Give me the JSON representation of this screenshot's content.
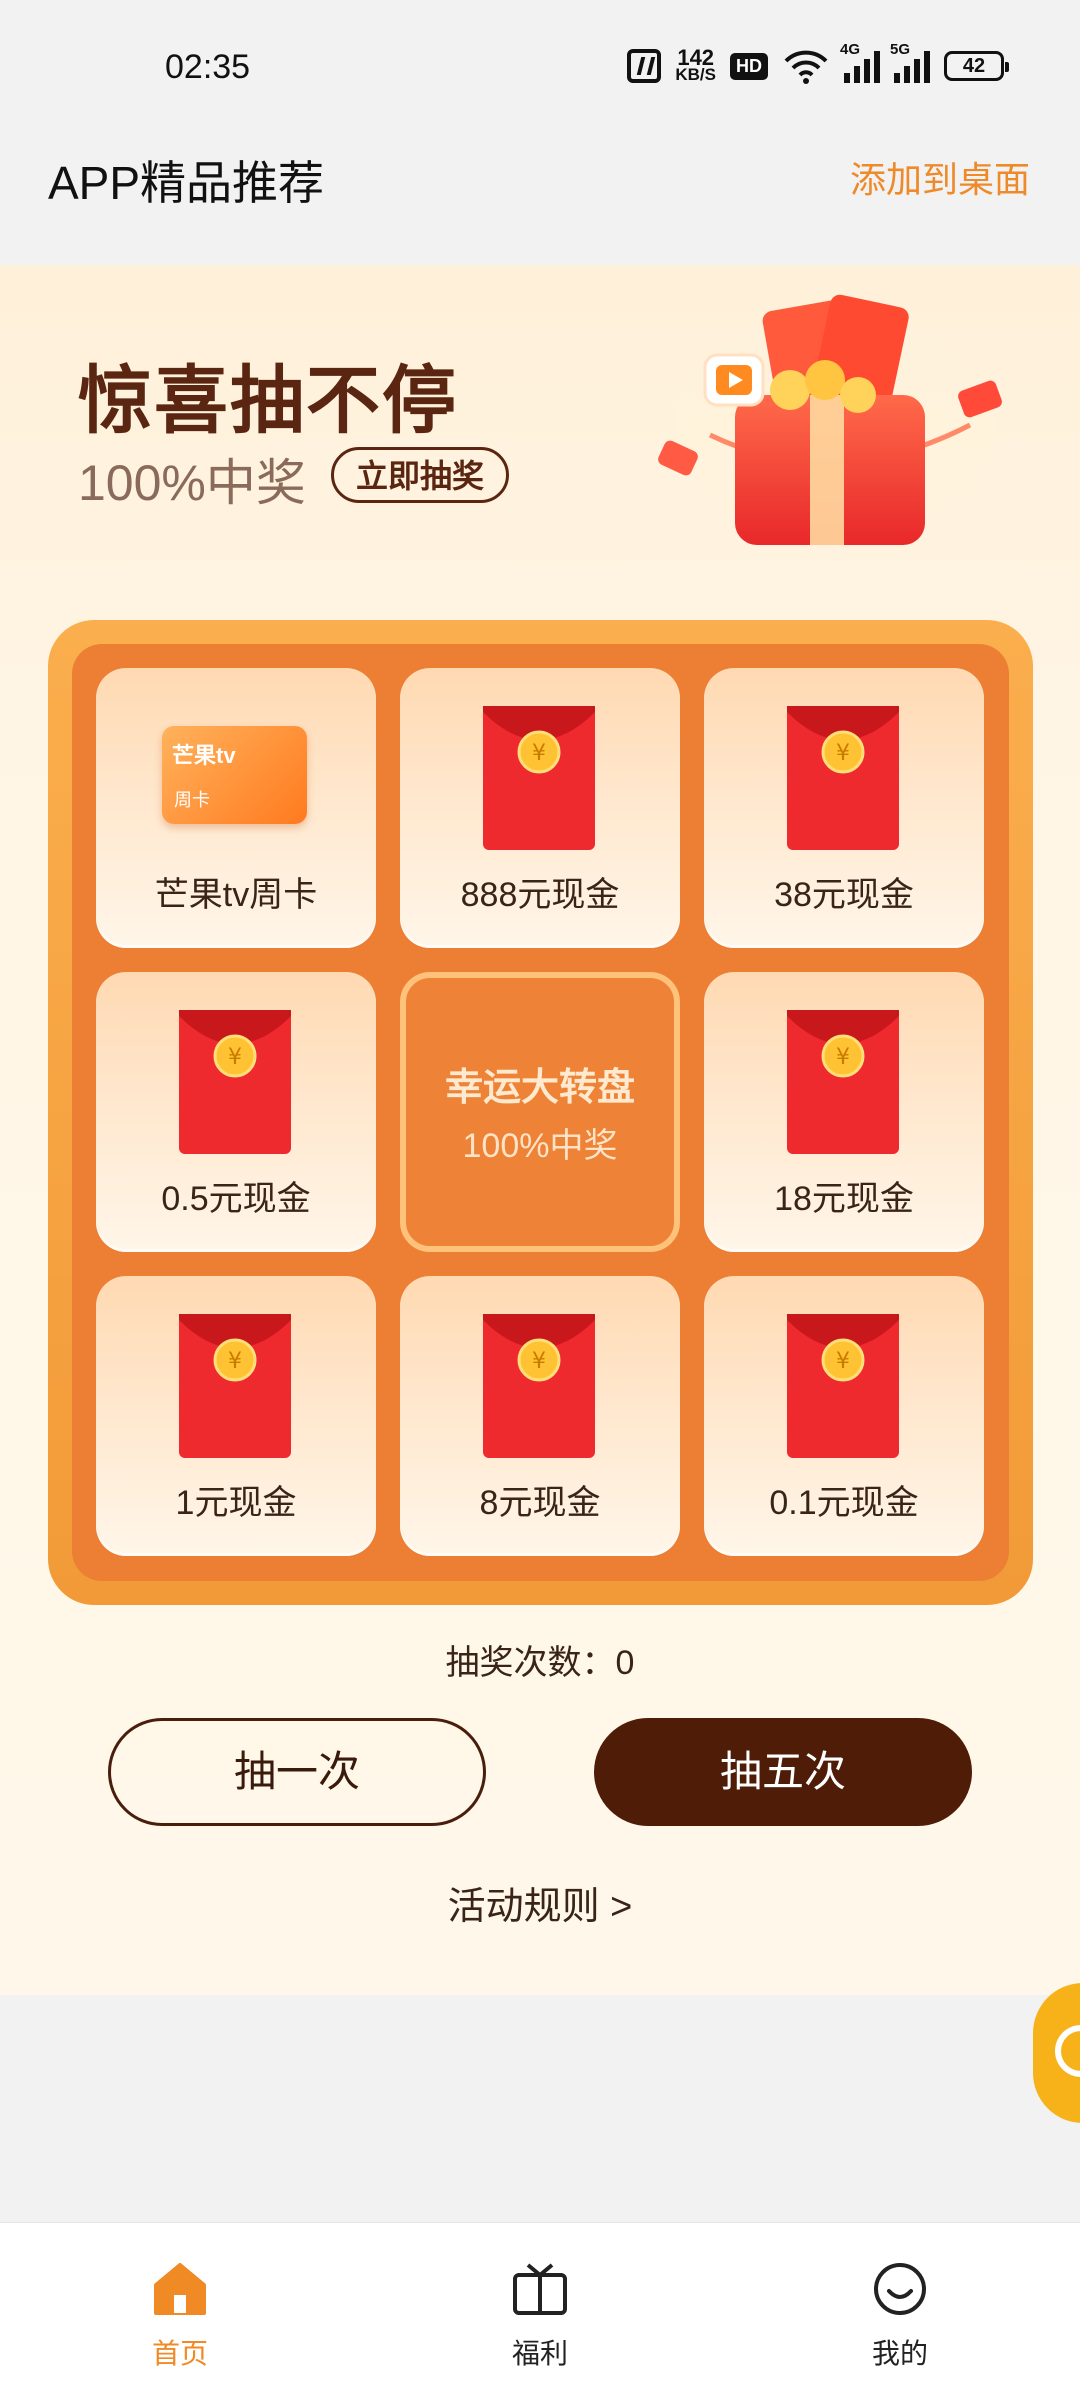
{
  "status": {
    "time": "02:35",
    "net_speed": "142",
    "net_unit": "KB/S",
    "hd": "HD",
    "sig1": "4G",
    "sig2": "5G",
    "battery": "42"
  },
  "header": {
    "title": "APP精品推荐",
    "add_to_desktop": "添加到桌面"
  },
  "banner": {
    "title": "惊喜抽不停",
    "subtitle": "100%中奖",
    "draw_now": "立即抽奖"
  },
  "grid": {
    "items": [
      {
        "label": "芒果tv周卡",
        "card_brand": "芒果tv",
        "card_type": "周卡"
      },
      {
        "label": "888元现金"
      },
      {
        "label": "38元现金"
      },
      {
        "label": "0.5元现金"
      },
      {
        "label": "18元现金"
      },
      {
        "label": "1元现金"
      },
      {
        "label": "8元现金"
      },
      {
        "label": "0.1元现金"
      }
    ],
    "center_title": "幸运大转盘",
    "center_sub": "100%中奖"
  },
  "draw": {
    "count_label": "抽奖次数：0",
    "once": "抽一次",
    "five": "抽五次",
    "rules": "活动规则 >"
  },
  "tabs": [
    {
      "label": "首页",
      "active": true
    },
    {
      "label": "福利"
    },
    {
      "label": "我的"
    }
  ],
  "colors": {
    "accent": "#f08a24",
    "brown": "#4f1c07",
    "grid_bg": "#ec7f33"
  }
}
